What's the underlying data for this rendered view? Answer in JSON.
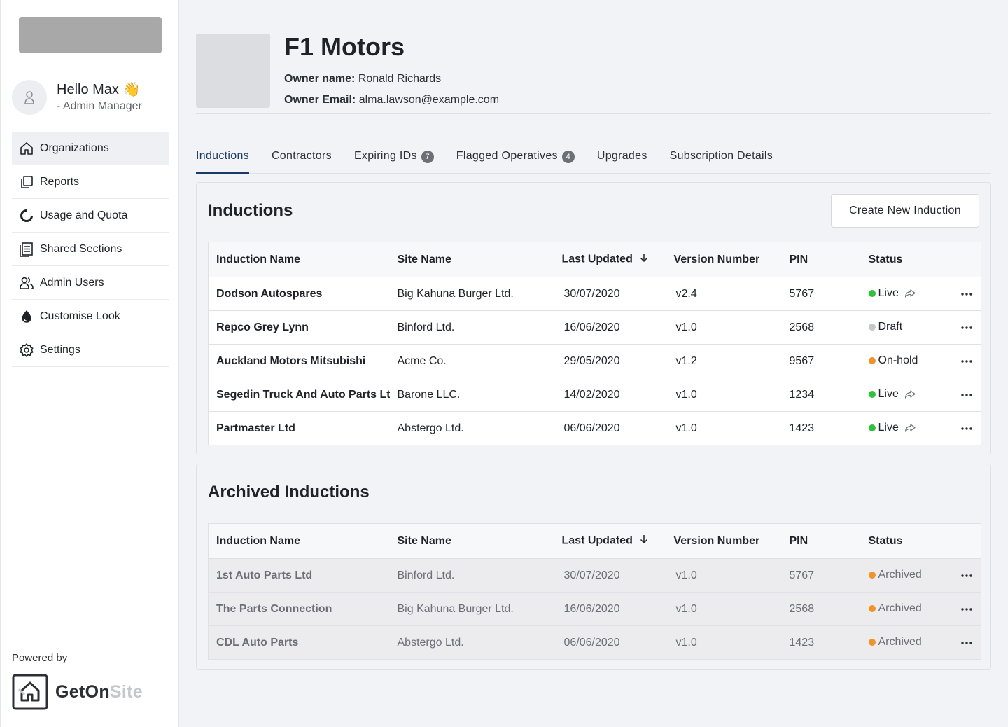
{
  "sidebar": {
    "user": {
      "greeting": "Hello Max 👋",
      "role": "- Admin Manager"
    },
    "nav": [
      {
        "label": "Organizations",
        "icon": "home-icon"
      },
      {
        "label": "Reports",
        "icon": "copy-icon"
      },
      {
        "label": "Usage and Quota",
        "icon": "donut-icon"
      },
      {
        "label": "Shared Sections",
        "icon": "document-icon"
      },
      {
        "label": "Admin Users",
        "icon": "users-icon"
      },
      {
        "label": "Customise Look",
        "icon": "drop-icon"
      },
      {
        "label": "Settings",
        "icon": "gear-icon"
      }
    ],
    "active_item": "Organizations",
    "powered_by": "Powered by",
    "brand": {
      "part1": "GetOn",
      "part2": "Site"
    }
  },
  "header": {
    "org_name": "F1 Motors",
    "owner_name_label": "Owner name:",
    "owner_name": "Ronald Richards",
    "owner_email_label": "Owner Email:",
    "owner_email": "alma.lawson@example.com"
  },
  "tabs": [
    {
      "label": "Inductions",
      "active": true
    },
    {
      "label": "Contractors"
    },
    {
      "label": "Expiring IDs",
      "badge": "7"
    },
    {
      "label": "Flagged Operatives",
      "badge": "4"
    },
    {
      "label": "Upgrades"
    },
    {
      "label": "Subscription Details"
    }
  ],
  "columns": {
    "name": "Induction Name",
    "site": "Site Name",
    "updated": "Last Updated",
    "version": "Version Number",
    "pin": "PIN",
    "status": "Status"
  },
  "inductions": {
    "title": "Inductions",
    "create_label": "Create New Induction",
    "rows": [
      {
        "name": "Dodson Autospares",
        "site": "Big Kahuna Burger Ltd.",
        "updated": "30/07/2020",
        "version": "v2.4",
        "pin": "5767",
        "status": "Live",
        "shared": true
      },
      {
        "name": "Repco Grey Lynn",
        "site": "Binford Ltd.",
        "updated": "16/06/2020",
        "version": "v1.0",
        "pin": "2568",
        "status": "Draft",
        "shared": false
      },
      {
        "name": "Auckland Motors Mitsubishi",
        "site": "Acme Co.",
        "updated": "29/05/2020",
        "version": "v1.2",
        "pin": "9567",
        "status": "On-hold",
        "shared": false
      },
      {
        "name": "Segedin Truck And Auto Parts Ltd (",
        "site": "Barone LLC.",
        "updated": "14/02/2020",
        "version": "v1.0",
        "pin": "1234",
        "status": "Live",
        "shared": true
      },
      {
        "name": "Partmaster Ltd",
        "site": "Abstergo Ltd.",
        "updated": "06/06/2020",
        "version": "v1.0",
        "pin": "1423",
        "status": "Live",
        "shared": true
      }
    ]
  },
  "archived": {
    "title": "Archived Inductions",
    "rows": [
      {
        "name": "1st Auto Parts Ltd",
        "site": "Binford Ltd.",
        "updated": "30/07/2020",
        "version": "v1.0",
        "pin": "5767",
        "status": "Archived"
      },
      {
        "name": "The Parts Connection",
        "site": "Big Kahuna Burger Ltd.",
        "updated": "16/06/2020",
        "version": "v1.0",
        "pin": "2568",
        "status": "Archived"
      },
      {
        "name": "CDL Auto Parts",
        "site": "Abstergo Ltd.",
        "updated": "06/06/2020",
        "version": "v1.0",
        "pin": "1423",
        "status": "Archived"
      }
    ]
  },
  "status_colors": {
    "Live": "#2ec23a",
    "Draft": "#c4c6ca",
    "On-hold": "#f0932b",
    "Archived": "#f0932b"
  }
}
